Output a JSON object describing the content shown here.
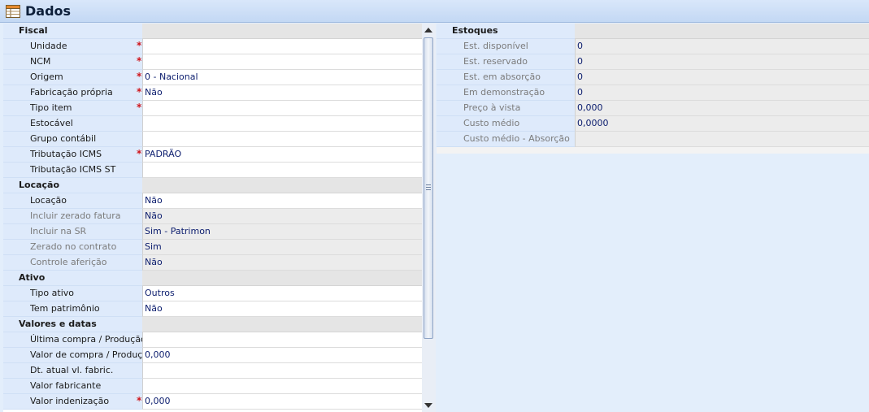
{
  "window": {
    "title": "Dados",
    "icon": "table-icon"
  },
  "left_panel": {
    "groups": [
      {
        "name": "Fiscal",
        "rows": [
          {
            "label": "Unidade",
            "value": "",
            "required": true,
            "disabled": false
          },
          {
            "label": "NCM",
            "value": "",
            "required": true,
            "disabled": false
          },
          {
            "label": "Origem",
            "value": "0 - Nacional",
            "required": true,
            "disabled": false
          },
          {
            "label": "Fabricação própria",
            "value": "Não",
            "required": true,
            "disabled": false
          },
          {
            "label": "Tipo item",
            "value": "",
            "required": true,
            "disabled": false
          },
          {
            "label": "Estocável",
            "value": "",
            "required": false,
            "disabled": false
          },
          {
            "label": "Grupo contábil",
            "value": "",
            "required": false,
            "disabled": false
          },
          {
            "label": "Tributação ICMS",
            "value": "PADRÃO",
            "required": true,
            "disabled": false
          },
          {
            "label": "Tributação ICMS ST",
            "value": "",
            "required": false,
            "disabled": false
          }
        ]
      },
      {
        "name": "Locação",
        "rows": [
          {
            "label": "Locação",
            "value": "Não",
            "required": false,
            "disabled": false
          },
          {
            "label": "Incluir zerado fatura",
            "value": "Não",
            "required": false,
            "disabled": true
          },
          {
            "label": "Incluir na SR",
            "value": "Sim - Patrimon",
            "required": false,
            "disabled": true
          },
          {
            "label": "Zerado no contrato",
            "value": "Sim",
            "required": false,
            "disabled": true
          },
          {
            "label": "Controle aferição",
            "value": "Não",
            "required": false,
            "disabled": true
          }
        ]
      },
      {
        "name": "Ativo",
        "rows": [
          {
            "label": "Tipo ativo",
            "value": "Outros",
            "required": false,
            "disabled": false
          },
          {
            "label": "Tem patrimônio",
            "value": "Não",
            "required": false,
            "disabled": false
          }
        ]
      },
      {
        "name": "Valores e datas",
        "rows": [
          {
            "label": "Última compra / Produção",
            "value": "",
            "required": false,
            "disabled": false
          },
          {
            "label": "Valor de compra / Produção",
            "value": "0,000",
            "required": false,
            "disabled": false
          },
          {
            "label": "Dt. atual vl. fabric.",
            "value": "",
            "required": false,
            "disabled": false
          },
          {
            "label": "Valor fabricante",
            "value": "",
            "required": false,
            "disabled": false
          },
          {
            "label": "Valor indenização",
            "value": "0,000",
            "required": true,
            "disabled": false
          }
        ]
      }
    ],
    "required_mark": "*"
  },
  "right_panel": {
    "groups": [
      {
        "name": "Estoques",
        "rows": [
          {
            "label": "Est. disponível",
            "value": "0"
          },
          {
            "label": "Est. reservado",
            "value": "0"
          },
          {
            "label": "Est. em absorção",
            "value": "0"
          },
          {
            "label": "Em demonstração",
            "value": "0"
          },
          {
            "label": "Preço à vista",
            "value": "0,000"
          },
          {
            "label": "Custo médio",
            "value": "0,0000"
          },
          {
            "label": "Custo médio - Absorção",
            "value": ""
          }
        ]
      }
    ]
  },
  "colors": {
    "required": "#d0141a",
    "value_text": "#0f2070",
    "label_bg": "#deeafb"
  }
}
